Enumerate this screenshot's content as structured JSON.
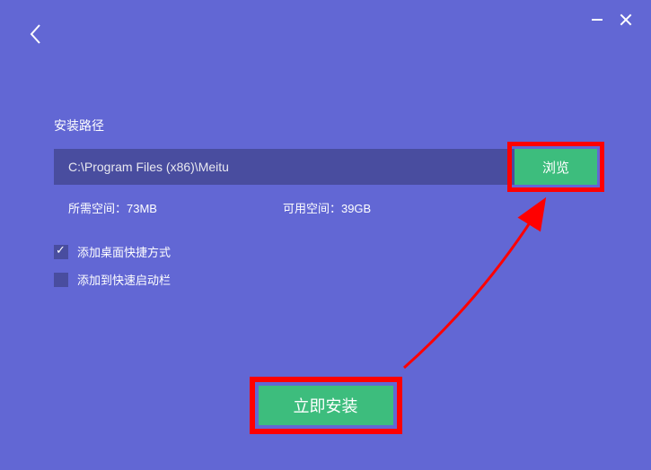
{
  "labels": {
    "install_path": "安装路径",
    "path_value": "C:\\Program Files (x86)\\Meitu",
    "browse": "浏览",
    "required_space": "所需空间：73MB",
    "available_space": "可用空间：39GB",
    "desktop_shortcut": "添加桌面快捷方式",
    "quick_launch": "添加到快速启动栏",
    "install_now": "立即安装"
  },
  "checkboxes": {
    "desktop_shortcut": true,
    "quick_launch": false
  },
  "colors": {
    "background": "#6267d4",
    "accent": "#3dbd7d",
    "highlight": "#ff0000"
  }
}
